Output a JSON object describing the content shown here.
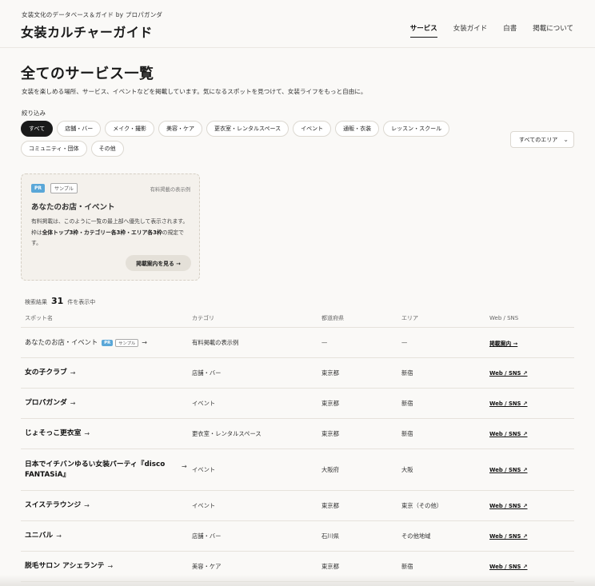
{
  "header": {
    "tagline": "女装文化のデータベース＆ガイド by プロパガンダ",
    "site_title": "女装カルチャーガイド",
    "nav": [
      "サービス",
      "女装ガイド",
      "白書",
      "掲載について"
    ]
  },
  "main": {
    "page_title": "全てのサービス一覧",
    "lead": "女装を楽しめる場所、サービス、イベントなどを掲載しています。気になるスポットを見つけて、女装ライフをもっと自由に。",
    "filter_label": "絞り込み",
    "chips": [
      "すべて",
      "店舗・バー",
      "メイク・撮影",
      "美容・ケア",
      "更衣室・レンタルスペース",
      "イベント",
      "通販・衣装",
      "レッスン・スクール",
      "コミュニティ・団体",
      "その他"
    ],
    "area_select": "すべてのエリア"
  },
  "pr_card": {
    "badge_pr": "PR",
    "badge_sample": "サンプル",
    "note": "有料掲載の表示例",
    "title": "あなたのお店・イベント",
    "desc_1": "有料掲載は、このように一覧の最上部へ優先して表示されます。枠は",
    "desc_bold": "全体トップ3枠・カテゴリー各3枠・エリア各3枠",
    "desc_2": "の規定です。",
    "button": "掲載案内を見る →"
  },
  "results": {
    "prefix": "検索結果",
    "count": "31",
    "suffix": "件を表示中"
  },
  "table": {
    "headers": [
      "スポット名",
      "カテゴリ",
      "都道府県",
      "エリア",
      "Web / SNS"
    ],
    "pr_row": {
      "name": "あなたのお店・イベント",
      "badge_pr": "PR",
      "badge_sample": "サンプル",
      "category": "有料掲載の表示例",
      "pref": "—",
      "area": "—",
      "link": "掲載案内 →"
    },
    "rows": [
      {
        "name": "女の子クラブ",
        "category": "店舗・バー",
        "pref": "東京都",
        "area": "新宿",
        "link": "Web / SNS ↗"
      },
      {
        "name": "プロパガンダ",
        "category": "イベント",
        "pref": "東京都",
        "area": "新宿",
        "link": "Web / SNS ↗"
      },
      {
        "name": "じょそっこ更衣室",
        "category": "更衣室・レンタルスペース",
        "pref": "東京都",
        "area": "新宿",
        "link": "Web / SNS ↗"
      },
      {
        "name": "日本でイチバンゆるい女装パーティ『disco FANTASiA』",
        "category": "イベント",
        "pref": "大阪府",
        "area": "大阪",
        "link": "Web / SNS ↗"
      },
      {
        "name": "スイステラウンジ",
        "category": "イベント",
        "pref": "東京都",
        "area": "東京（その他）",
        "link": "Web / SNS ↗"
      },
      {
        "name": "ユニバル",
        "category": "店舗・バー",
        "pref": "石川県",
        "area": "その他地域",
        "link": "Web / SNS ↗"
      },
      {
        "name": "脱毛サロン アシェランテ",
        "category": "美容・ケア",
        "pref": "東京都",
        "area": "新宿",
        "link": "Web / SNS ↗"
      }
    ]
  },
  "colors": {
    "background": "#faf9f7",
    "pr_badge": "#5aa7d8",
    "active_chip": "#1a1a1a"
  },
  "arrow": "→",
  "chevron": "⌄"
}
